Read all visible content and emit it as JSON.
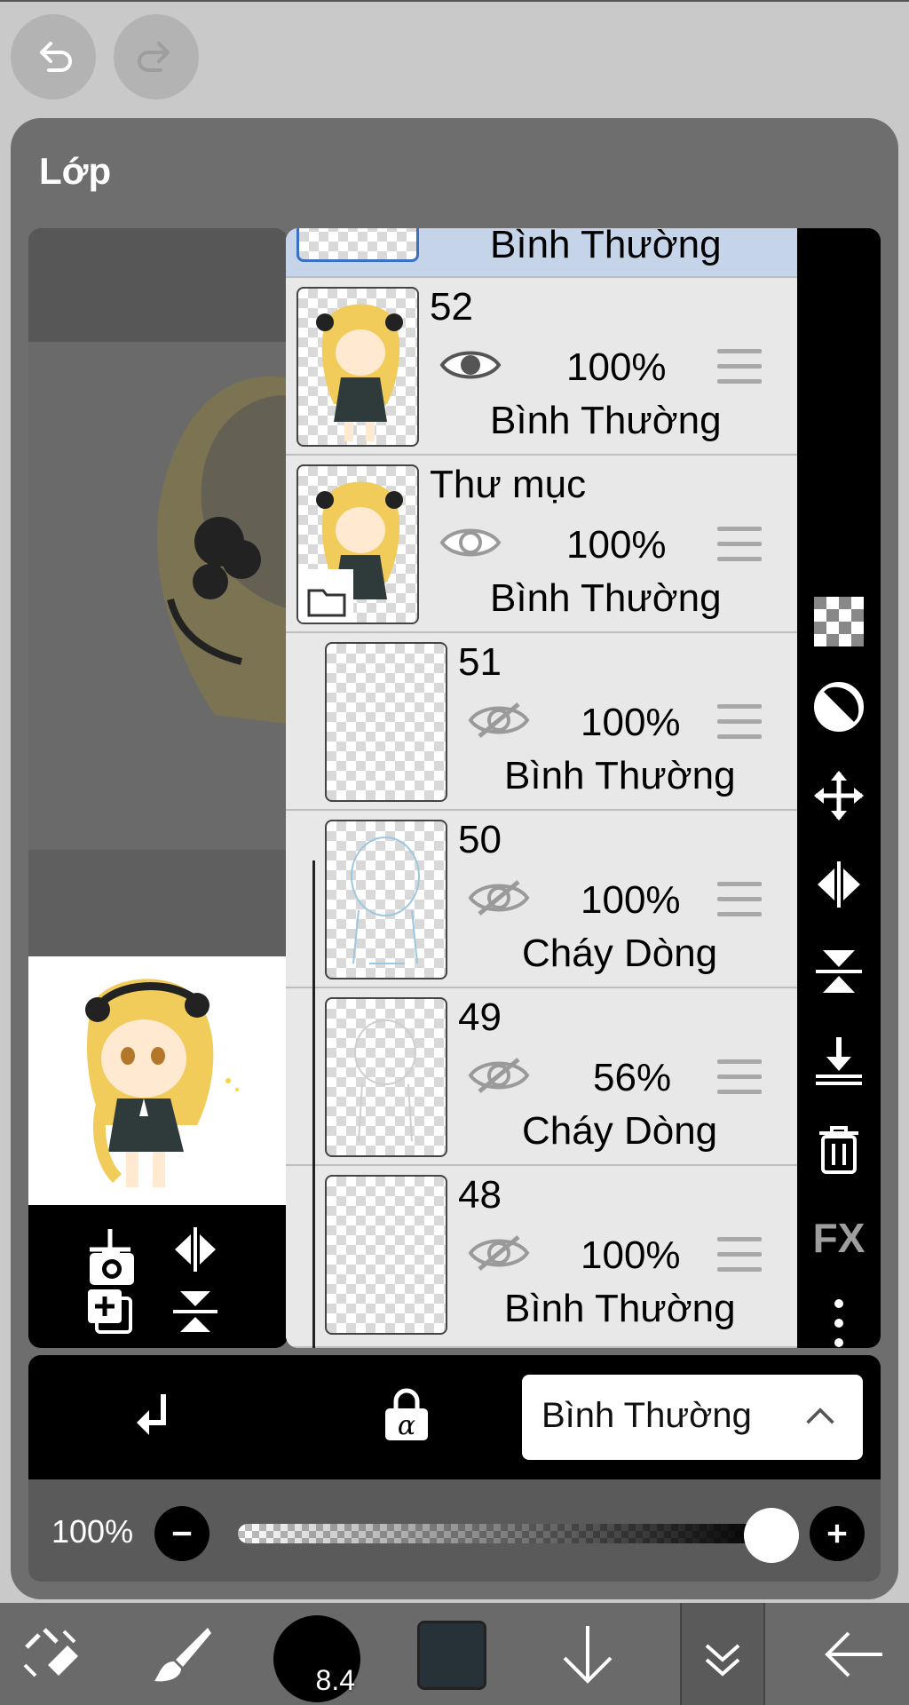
{
  "panel": {
    "title": "Lớp"
  },
  "layers": [
    {
      "name": "",
      "opacity": "",
      "blend": "Bình Thường",
      "visible": true,
      "selected": true
    },
    {
      "name": "52",
      "opacity": "100%",
      "blend": "Bình Thường",
      "visible": true
    },
    {
      "name": "Thư mục",
      "opacity": "100%",
      "blend": "Bình Thường",
      "visible": true,
      "is_folder": true
    },
    {
      "name": "51",
      "opacity": "100%",
      "blend": "Bình Thường",
      "visible": false
    },
    {
      "name": "50",
      "opacity": "100%",
      "blend": "Cháy Dòng",
      "visible": false
    },
    {
      "name": "49",
      "opacity": "56%",
      "blend": "Cháy Dòng",
      "visible": false
    },
    {
      "name": "48",
      "opacity": "100%",
      "blend": "Bình Thường",
      "visible": false
    }
  ],
  "side_tools": [
    "checker-icon",
    "half-circle-icon",
    "move-icon",
    "flip-horizontal-icon",
    "flip-vertical-icon",
    "merge-down-icon",
    "trash-icon",
    "fx-icon",
    "more-icon"
  ],
  "side_fx_label": "FX",
  "preview_tools": [
    "add-layer-icon",
    "flip-horizontal-icon",
    "duplicate-layer-icon",
    "flip-vertical-icon",
    "camera-icon"
  ],
  "bottom_bar": {
    "blend_mode": "Bình Thường"
  },
  "opacity_control": {
    "value_label": "100%",
    "level": 1.0
  },
  "footer": {
    "brush_size": "8.4",
    "color": "#263238"
  },
  "colors": {
    "panel": "#6e6e6e",
    "accent_selected": "#c6d4e9"
  }
}
